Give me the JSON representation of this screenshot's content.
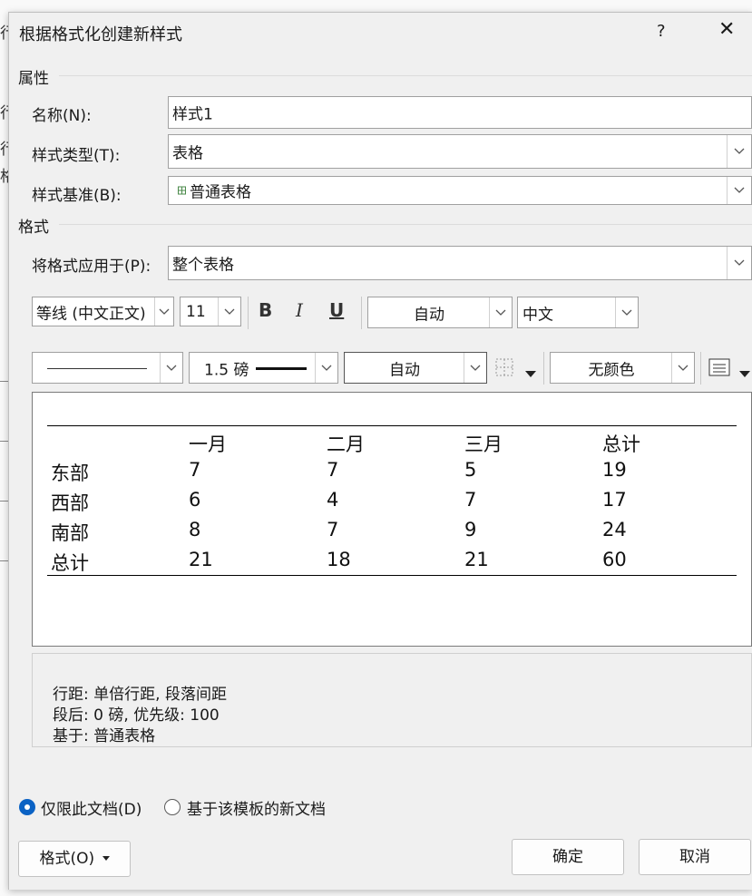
{
  "dialog": {
    "title": "根据格式化创建新样式",
    "help": "?",
    "close": "✕"
  },
  "background_fragments": [
    "行",
    "行",
    "行",
    "格"
  ],
  "properties": {
    "section": "属性",
    "name_label": "名称(N):",
    "name_value": "样式1",
    "type_label": "样式类型(T):",
    "type_value": "表格",
    "based_label": "样式基准(B):",
    "based_value": "普通表格"
  },
  "format": {
    "section": "格式",
    "apply_label": "将格式应用于(P):",
    "apply_value": "整个表格",
    "font": "等线 (中文正文)",
    "size": "11",
    "bold": "B",
    "italic": "I",
    "underline": "U",
    "color": "自动",
    "script": "中文",
    "border_weight": "1.5 磅",
    "border_color": "自动",
    "shading": "无颜色"
  },
  "preview": {
    "headers": [
      "",
      "一月",
      "二月",
      "三月",
      "总计"
    ],
    "rows": [
      [
        "东部",
        "7",
        "7",
        "5",
        "19"
      ],
      [
        "西部",
        "6",
        "4",
        "7",
        "17"
      ],
      [
        "南部",
        "8",
        "7",
        "9",
        "24"
      ],
      [
        "总计",
        "21",
        "18",
        "21",
        "60"
      ]
    ]
  },
  "description": {
    "line1": "行距: 单倍行距, 段落间距",
    "line2": "段后: 0 磅, 优先级: 100",
    "line3": "基于: 普通表格"
  },
  "scope": {
    "option1": "仅限此文档(D)",
    "option1_selected": true,
    "option2": "基于该模板的新文档"
  },
  "buttons": {
    "format": "格式(O)",
    "ok": "确定",
    "cancel": "取消"
  }
}
